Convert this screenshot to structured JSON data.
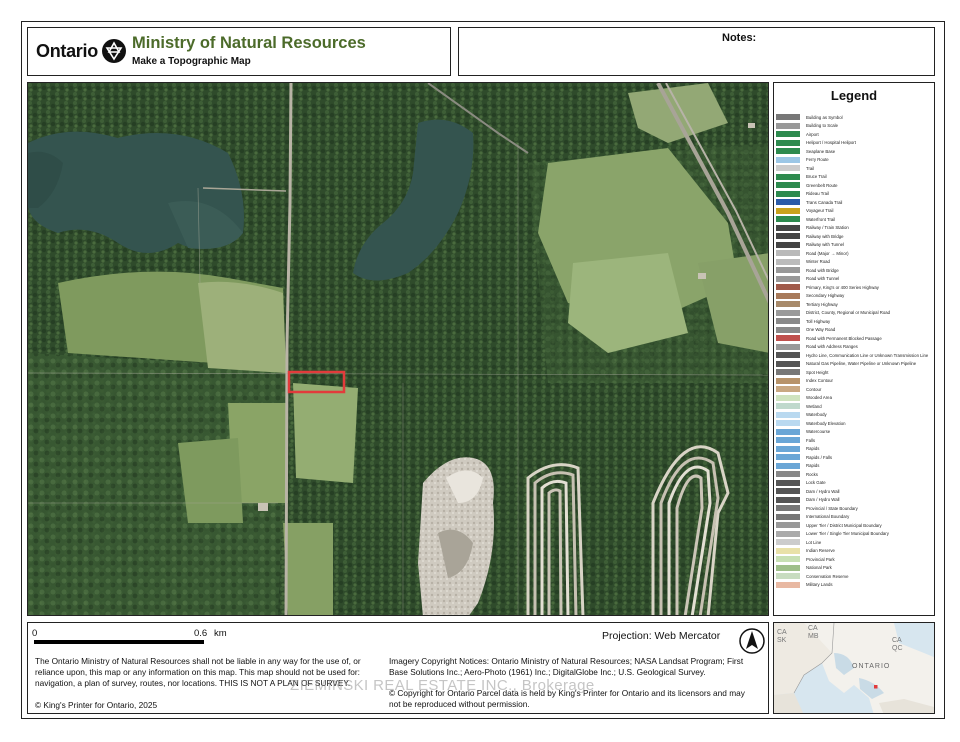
{
  "header": {
    "ontario_wordmark": "Ontario",
    "ministry_title": "Ministry of Natural Resources",
    "subtitle": "Make a Topographic Map",
    "notes_label": "Notes:"
  },
  "legend": {
    "title": "Legend",
    "items": [
      {
        "label": "Building as Symbol",
        "color": "#777777"
      },
      {
        "label": "Building to Scale",
        "color": "#999999"
      },
      {
        "label": "Airport",
        "color": "#2d8a4e"
      },
      {
        "label": "Heliport / Hospital Heliport",
        "color": "#2d8a4e"
      },
      {
        "label": "Seaplane Base",
        "color": "#2d8a4e"
      },
      {
        "label": "Ferry Route",
        "color": "#9cc7e6"
      },
      {
        "label": "Trail",
        "color": "#cccccc"
      },
      {
        "label": "Bruce Trail",
        "color": "#2d8a4e"
      },
      {
        "label": "Greenbelt Route",
        "color": "#2d8a4e"
      },
      {
        "label": "Rideau Trail",
        "color": "#2d8a4e"
      },
      {
        "label": "Trans Canada Trail",
        "color": "#2a5aa8"
      },
      {
        "label": "Voyageur Trail",
        "color": "#c9a21c"
      },
      {
        "label": "Waterfront Trail",
        "color": "#2d8a4e"
      },
      {
        "label": "Railway / Train Station",
        "color": "#444444"
      },
      {
        "label": "Railway with Bridge",
        "color": "#444444"
      },
      {
        "label": "Railway with Tunnel",
        "color": "#444444"
      },
      {
        "label": "Road (Major → Minor)",
        "color": "#b9b9b9"
      },
      {
        "label": "Winter Road",
        "color": "#bbbbbb"
      },
      {
        "label": "Road with Bridge",
        "color": "#999999"
      },
      {
        "label": "Road with Tunnel",
        "color": "#999999"
      },
      {
        "label": "Primary, King's or 400 Series Highway",
        "color": "#a05a4a"
      },
      {
        "label": "Secondary Highway",
        "color": "#a87a5a"
      },
      {
        "label": "Tertiary Highway",
        "color": "#a88a6a"
      },
      {
        "label": "District, County, Regional or Municipal Road",
        "color": "#9a9a9a"
      },
      {
        "label": "Toll Highway",
        "color": "#8a8a8a"
      },
      {
        "label": "One Way Road",
        "color": "#8a8a8a"
      },
      {
        "label": "Road with Permanent Blocked Passage",
        "color": "#c0504d"
      },
      {
        "label": "Road with Address Ranges",
        "color": "#999999"
      },
      {
        "label": "Hydro Line, Communication Line or Unknown Transmission Line",
        "color": "#555555"
      },
      {
        "label": "Natural Gas Pipeline, Water Pipeline or Unknown Pipeline",
        "color": "#555555"
      },
      {
        "label": "Spot Height",
        "color": "#777777"
      },
      {
        "label": "Index Contour",
        "color": "#b7936a"
      },
      {
        "label": "Contour",
        "color": "#c9a882"
      },
      {
        "label": "Wooded Area",
        "color": "#cfe3bf"
      },
      {
        "label": "Wetland",
        "color": "#bfd9cc"
      },
      {
        "label": "Waterbody",
        "color": "#b9d9f0"
      },
      {
        "label": "Waterbody Elevation",
        "color": "#b9d9f0"
      },
      {
        "label": "Watercourse",
        "color": "#6aa6d6"
      },
      {
        "label": "Falls",
        "color": "#6aa6d6"
      },
      {
        "label": "Rapids",
        "color": "#6aa6d6"
      },
      {
        "label": "Rapids / Falls",
        "color": "#6aa6d6"
      },
      {
        "label": "Rapids",
        "color": "#6aa6d6"
      },
      {
        "label": "Rocks",
        "color": "#888888"
      },
      {
        "label": "Lock Gate",
        "color": "#555555"
      },
      {
        "label": "Dam / Hydro Wall",
        "color": "#555555"
      },
      {
        "label": "Dam / Hydro Wall",
        "color": "#555555"
      },
      {
        "label": "Provincial / State Boundary",
        "color": "#777777"
      },
      {
        "label": "International Boundary",
        "color": "#777777"
      },
      {
        "label": "Upper Tier / District Municipal Boundary",
        "color": "#999999"
      },
      {
        "label": "Lower Tier / Single Tier Municipal Boundary",
        "color": "#aaaaaa"
      },
      {
        "label": "Lot Line",
        "color": "#cccccc"
      },
      {
        "label": "Indian Reserve",
        "color": "#e9e1a8"
      },
      {
        "label": "Provincial Park",
        "color": "#c8e0b4"
      },
      {
        "label": "National Park",
        "color": "#9fbf8a"
      },
      {
        "label": "Conservation Reserve",
        "color": "#c8dcc0"
      },
      {
        "label": "Military Lands",
        "color": "#e8b8a2"
      }
    ]
  },
  "scale": {
    "start": "0",
    "end": "0.6",
    "unit": "km"
  },
  "projection": "Projection: Web Mercator",
  "disclaimer": "The Ontario Ministry of Natural Resources shall not be liable in any way for the use of, or reliance upon, this map or any information on this map.  This map should not be used for: navigation, a plan of survey, routes, nor locations. THIS IS NOT A PLAN OF SURVEY.",
  "copyright": "© King's Printer for Ontario,  2025",
  "imagery_notice": "Imagery Copyright Notices: Ontario Ministry of Natural Resources; NASA Landsat Program; First Base Solutions Inc.; Aero-Photo (1961) Inc.; DigitalGlobe Inc.; U.S. Geological Survey.",
  "parcel_notice": "© Copyright for Ontario Parcel data is held by King's Printer for Ontario and its licensors and may not be reproduced without permission.",
  "watermark": "ZIEMINSKI REAL ESTATE INC., Brokerage",
  "overview": {
    "labels": [
      "CA\nSK",
      "CA\nMB",
      "CA\nQC",
      "ONTARIO"
    ]
  },
  "colors": {
    "ministry_green": "#4c6b2a",
    "parcel_outline": "#e23b3b",
    "water": "#3a5f5a",
    "forest_dark": "#2e4a2a",
    "field": "#8aa46a"
  }
}
